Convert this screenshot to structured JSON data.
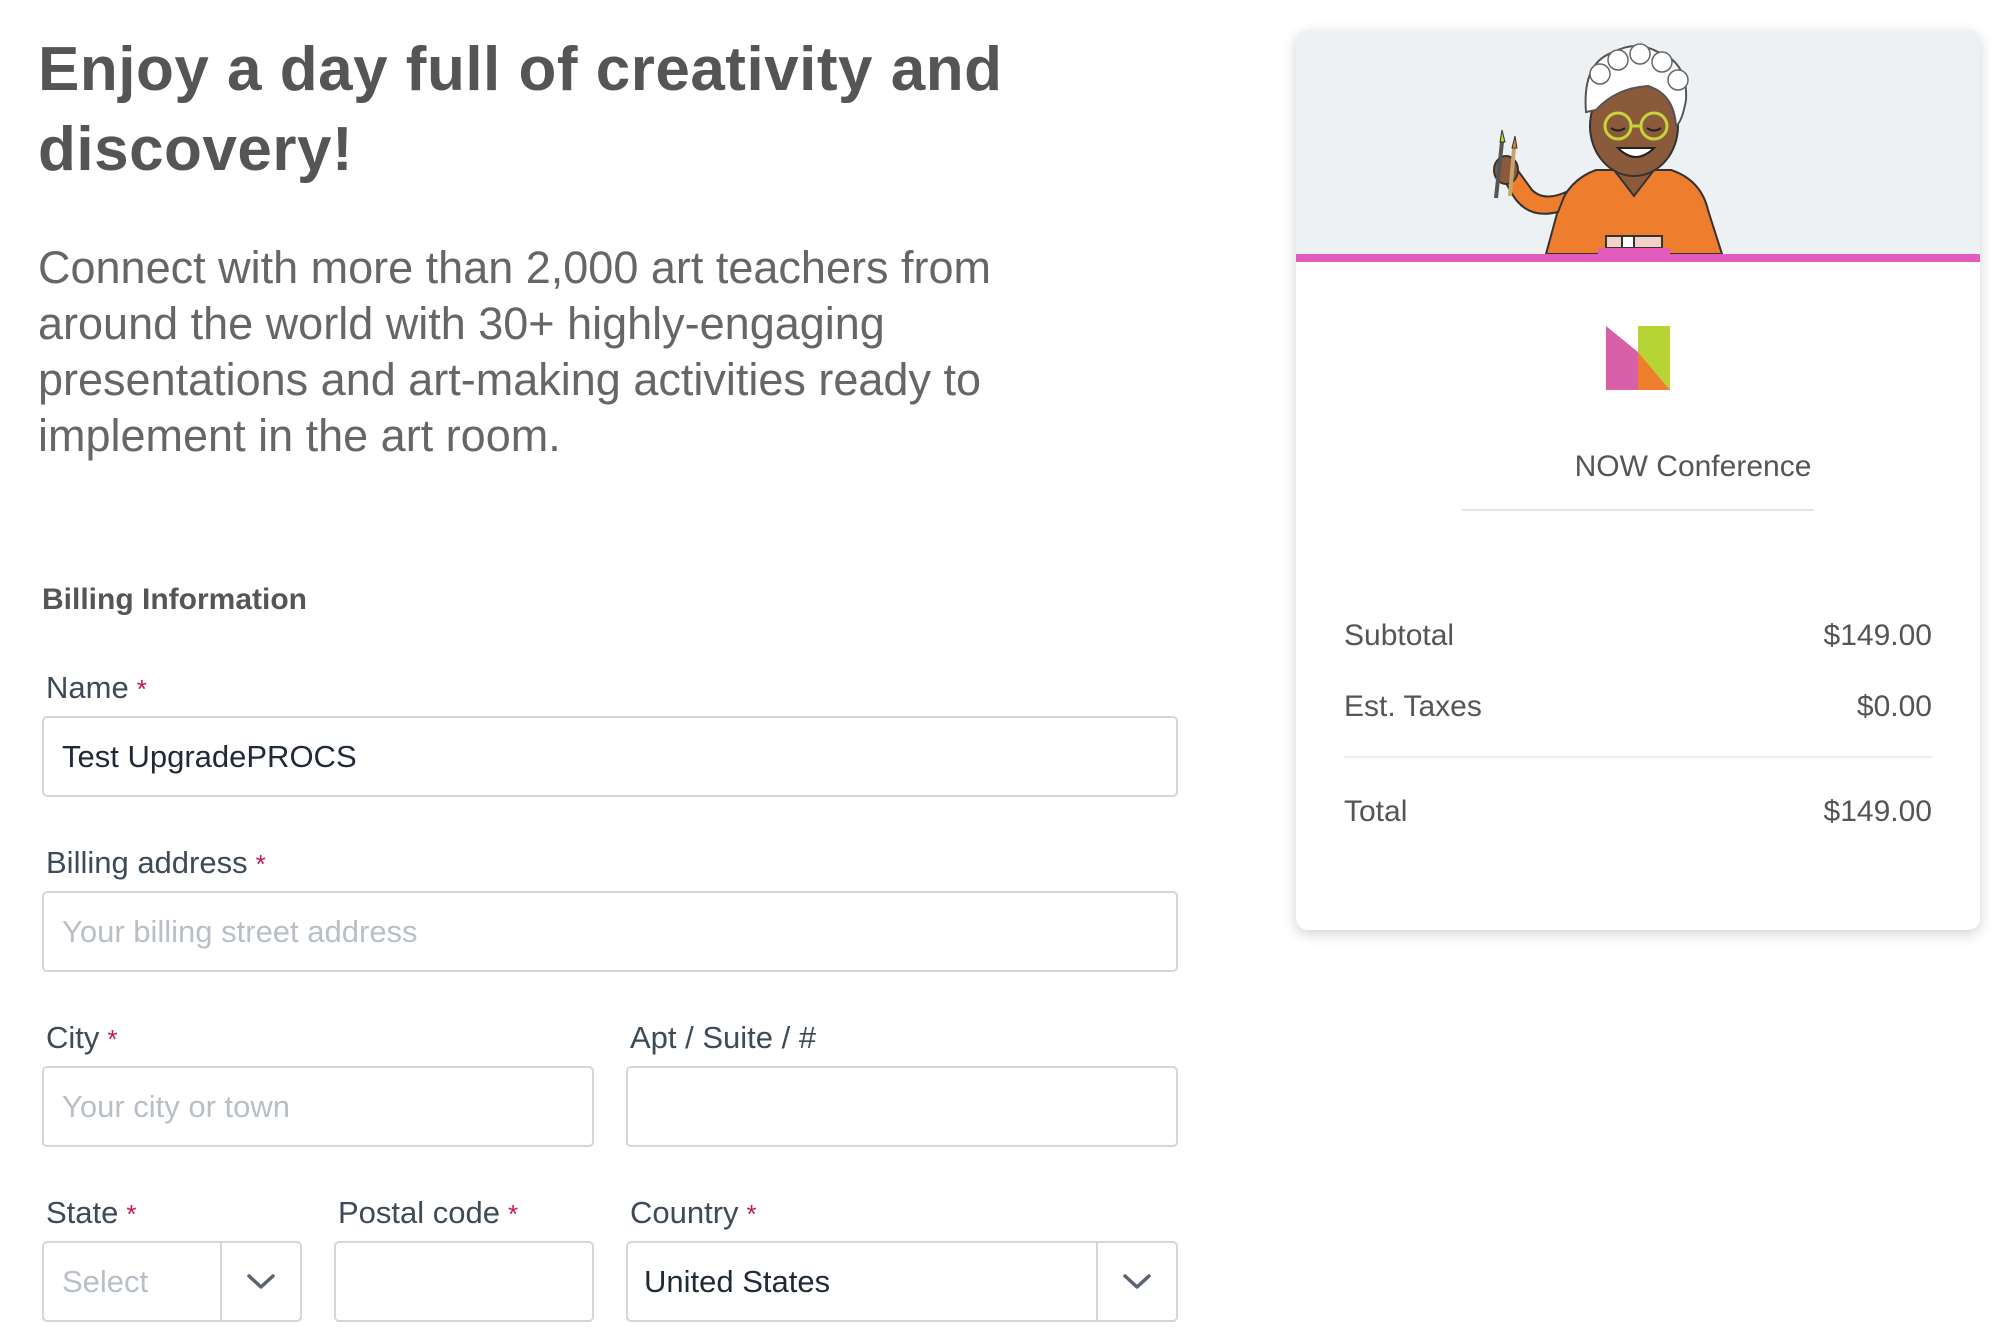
{
  "intro": {
    "headline": "Enjoy a day full of creativity and discovery!",
    "description": "Connect with more than 2,000 art teachers from around the world with 30+ highly-engaging presentations and art-making activities ready to implement in the art room."
  },
  "billing": {
    "section_title": "Billing Information",
    "required_marker": "*",
    "name": {
      "label": "Name",
      "value": "Test UpgradePROCS"
    },
    "address": {
      "label": "Billing address",
      "placeholder": "Your billing street address"
    },
    "city": {
      "label": "City",
      "placeholder": "Your city or town"
    },
    "apt": {
      "label": "Apt / Suite / #"
    },
    "state": {
      "label": "State",
      "placeholder": "Select"
    },
    "postal": {
      "label": "Postal code"
    },
    "country": {
      "label": "Country",
      "value": "United States"
    }
  },
  "summary": {
    "product_name": "NOW Conference",
    "subtotal_label": "Subtotal",
    "subtotal_value": "$149.00",
    "taxes_label": "Est. Taxes",
    "taxes_value": "$0.00",
    "total_label": "Total",
    "total_value": "$149.00"
  },
  "colors": {
    "accent_pink": "#e35bbb",
    "required": "#c2185b",
    "logo_pink": "#d95fa8",
    "logo_green": "#b6d433",
    "logo_orange": "#ef7d2e"
  },
  "icons": {
    "select_caret": "chevron-down-icon",
    "logo": "now-conference-logo",
    "hero": "teacher-illustration"
  }
}
